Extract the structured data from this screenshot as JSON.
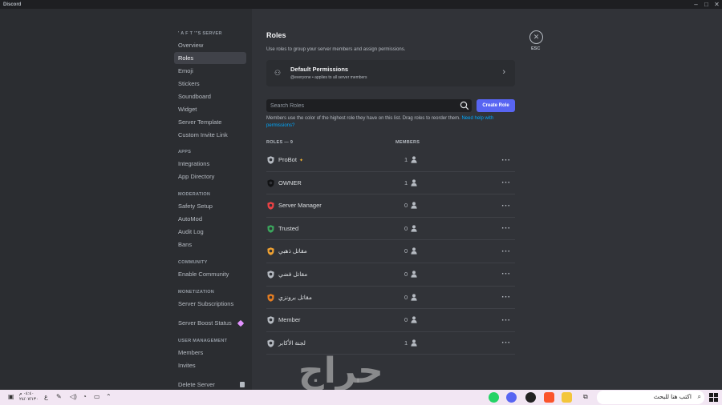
{
  "window": {
    "app_name": "Discord",
    "minimize": "–",
    "maximize": "□",
    "close": "✕"
  },
  "sidebar": {
    "server_header": "' A F T '\"S SERVER",
    "items": [
      {
        "label": "Overview"
      },
      {
        "label": "Roles"
      },
      {
        "label": "Emoji"
      },
      {
        "label": "Stickers"
      },
      {
        "label": "Soundboard"
      },
      {
        "label": "Widget"
      },
      {
        "label": "Server Template"
      },
      {
        "label": "Custom Invite Link"
      }
    ],
    "apps_header": "APPS",
    "apps_items": [
      {
        "label": "Integrations"
      },
      {
        "label": "App Directory"
      }
    ],
    "moderation_header": "MODERATION",
    "moderation_items": [
      {
        "label": "Safety Setup"
      },
      {
        "label": "AutoMod"
      },
      {
        "label": "Audit Log"
      },
      {
        "label": "Bans"
      }
    ],
    "community_header": "COMMUNITY",
    "community_items": [
      {
        "label": "Enable Community"
      }
    ],
    "monetization_header": "MONETIZATION",
    "monetization_items": [
      {
        "label": "Server Subscriptions"
      },
      {
        "label": "Server Boost Status"
      }
    ],
    "user_mgmt_header": "USER MANAGEMENT",
    "user_mgmt_items": [
      {
        "label": "Members"
      },
      {
        "label": "Invites"
      }
    ],
    "delete_label": "Delete Server",
    "active_item": "Roles"
  },
  "main": {
    "title": "Roles",
    "description": "Use roles to group your server members and assign permissions.",
    "esc_label": "ESC",
    "default_permissions": {
      "title": "Default Permissions",
      "subtitle": "@everyone • applies to all server members"
    },
    "search_placeholder": "Search Roles",
    "create_role_label": "Create Role",
    "hint_text": "Members use the color of the highest role they have on this list. Drag roles to reorder them.",
    "hint_link": "Need help with permissions?",
    "col_roles": "ROLES — 9",
    "col_members": "MEMBERS",
    "roles": [
      {
        "name": "ProBot",
        "badge": "✦",
        "members": "1",
        "color": "#b5bac1"
      },
      {
        "name": "OWNER",
        "badge": "",
        "members": "1",
        "color": "#111214"
      },
      {
        "name": "Server Manager",
        "badge": "",
        "members": "0",
        "color": "#ed4245"
      },
      {
        "name": "Trusted",
        "badge": "",
        "members": "0",
        "color": "#3ba55c"
      },
      {
        "name": "مقاتل ذهبي",
        "badge": "",
        "members": "0",
        "color": "#f0a232"
      },
      {
        "name": "مقاتل فضي",
        "badge": "",
        "members": "0",
        "color": "#b5bac1"
      },
      {
        "name": "مقاتل برونزي",
        "badge": "",
        "members": "0",
        "color": "#e67e22"
      },
      {
        "name": "Member",
        "badge": "",
        "members": "0",
        "color": "#b5bac1"
      },
      {
        "name": "لجنة الأكابر",
        "badge": "",
        "members": "1",
        "color": "#b5bac1"
      }
    ]
  },
  "watermark": "حراج",
  "taskbar": {
    "clock_time": "٠٤:٤٠ م",
    "clock_date": "٢٤/٠٧/١٣٠",
    "lang": "ع",
    "search_text": "اكتب هنا للبحث"
  }
}
